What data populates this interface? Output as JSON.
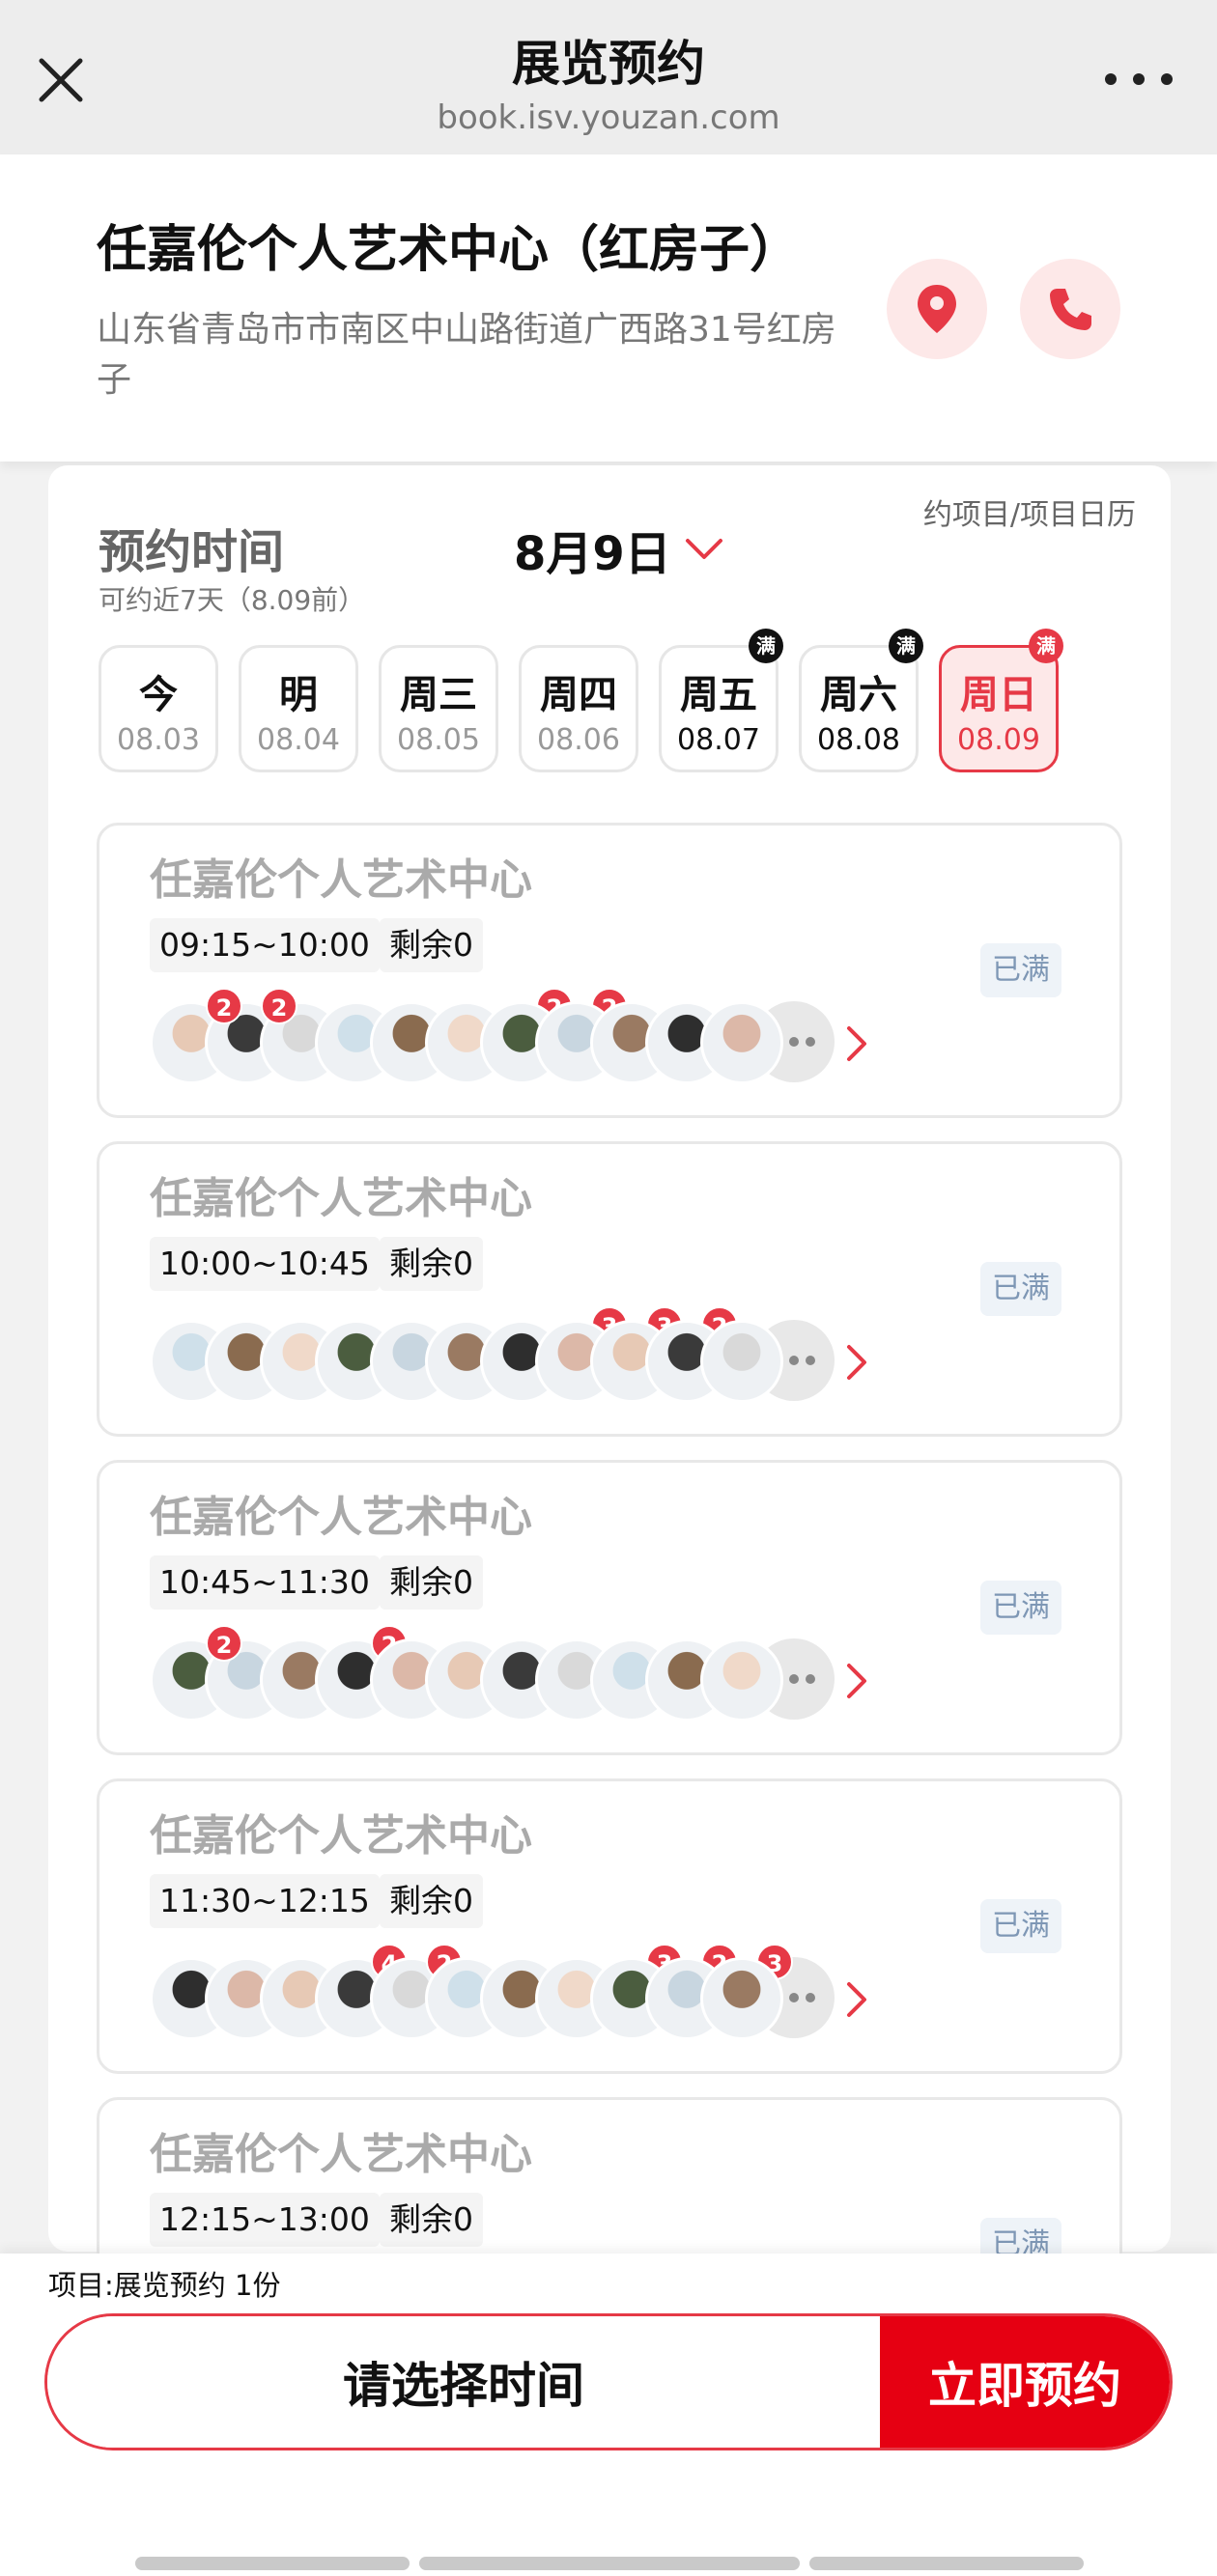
{
  "nav": {
    "title": "展览预约",
    "url": "book.isv.youzan.com",
    "close_icon": "close-icon",
    "more_icon": "more-icon"
  },
  "venue": {
    "name": "任嘉伦个人艺术中心（红房子）",
    "address": "山东省青岛市市南区中山路街道广西路31号红房子",
    "location_icon": "location-pin-icon",
    "phone_icon": "phone-icon"
  },
  "booking": {
    "calendar_link": "约项目/项目日历",
    "title": "预约时间",
    "subtitle": "可约近7天（8.09前）",
    "selected_date": "8月9日",
    "days": [
      {
        "weekday": "今",
        "date": "08.03",
        "full": "",
        "state": "past"
      },
      {
        "weekday": "明",
        "date": "08.04",
        "full": "",
        "state": "past"
      },
      {
        "weekday": "周三",
        "date": "08.05",
        "full": "",
        "state": "past"
      },
      {
        "weekday": "周四",
        "date": "08.06",
        "full": "",
        "state": "past"
      },
      {
        "weekday": "周五",
        "date": "08.07",
        "full": "满",
        "state": "avail"
      },
      {
        "weekday": "周六",
        "date": "08.08",
        "full": "满",
        "state": "avail"
      },
      {
        "weekday": "周日",
        "date": "08.09",
        "full": "满",
        "state": "selected"
      }
    ]
  },
  "slots": [
    {
      "name": "任嘉伦个人艺术中心",
      "time": "09:15~10:00",
      "remaining": "剩余0",
      "status": "已满",
      "counts": [
        "2",
        "2",
        "",
        "",
        "",
        "",
        "2",
        "2",
        "",
        "",
        ""
      ]
    },
    {
      "name": "任嘉伦个人艺术中心",
      "time": "10:00~10:45",
      "remaining": "剩余0",
      "status": "已满",
      "counts": [
        "",
        "",
        "",
        "",
        "",
        "",
        "",
        "3",
        "3",
        "2",
        ""
      ]
    },
    {
      "name": "任嘉伦个人艺术中心",
      "time": "10:45~11:30",
      "remaining": "剩余0",
      "status": "已满",
      "counts": [
        "2",
        "",
        "",
        "2",
        "",
        "",
        "",
        "",
        "",
        "",
        ""
      ]
    },
    {
      "name": "任嘉伦个人艺术中心",
      "time": "11:30~12:15",
      "remaining": "剩余0",
      "status": "已满",
      "counts": [
        "",
        "",
        "",
        "4",
        "2",
        "",
        "",
        "",
        "3",
        "2",
        "3"
      ]
    },
    {
      "name": "任嘉伦个人艺术中心",
      "time": "12:15~13:00",
      "remaining": "剩余0",
      "status": "已满",
      "counts": []
    }
  ],
  "avatar_colors": [
    "#e7c9b5",
    "#3a3a3a",
    "#d9d9d9",
    "#cfe0ea",
    "#8a6b4f",
    "#f0d9c9",
    "#4b5d3f",
    "#c8d6e0",
    "#9a7a62",
    "#2e2e2e",
    "#dcb8a8"
  ],
  "footer": {
    "project": "项目:展览预约 1份",
    "select_time": "请选择时间",
    "book_now": "立即预约"
  },
  "colors": {
    "accent": "#e63946",
    "book": "#e60012"
  }
}
